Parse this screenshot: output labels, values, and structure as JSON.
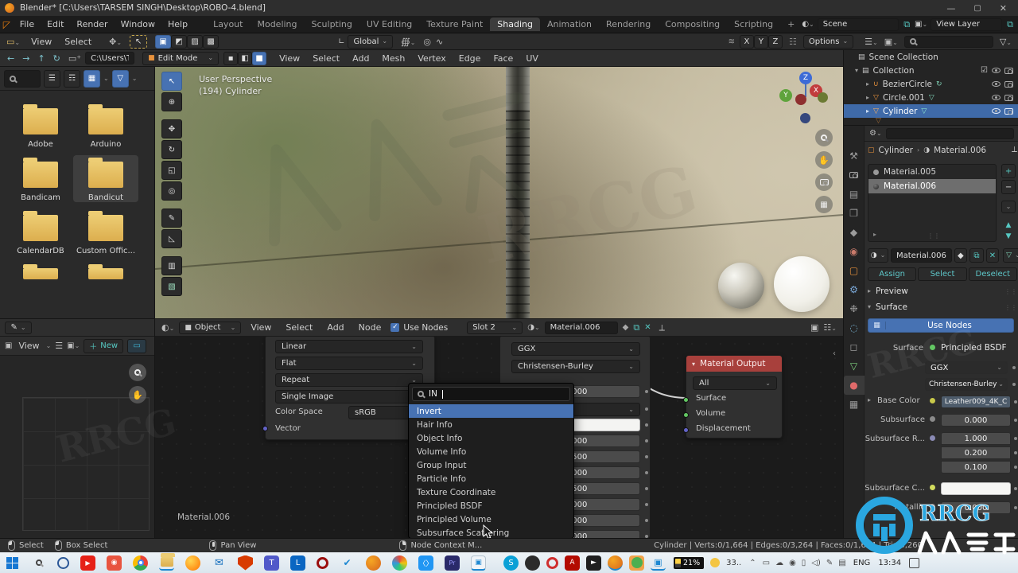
{
  "window": {
    "title": "Blender* [C:\\Users\\TARSEM SINGH\\Desktop\\ROBO-4.blend]"
  },
  "menubar": {
    "menus": [
      "File",
      "Edit",
      "Render",
      "Window",
      "Help"
    ],
    "tabs": [
      "Layout",
      "Modeling",
      "Sculpting",
      "UV Editing",
      "Texture Paint",
      "Shading",
      "Animation",
      "Rendering",
      "Compositing",
      "Scripting"
    ],
    "add_tab": "+",
    "scene_label": "Scene",
    "view_layer_label": "View Layer"
  },
  "toolrow": {
    "orientation": "Global",
    "mirror": [
      "X",
      "Y",
      "Z"
    ],
    "options": "Options"
  },
  "filebrowser": {
    "menus": [
      "View",
      "Select"
    ],
    "path": "C:\\Users\\T...",
    "folders": [
      "Adobe",
      "Arduino",
      "Bandicam",
      "Bandicut",
      "CalendarDB",
      "Custom Offic..."
    ]
  },
  "imageeditor": {
    "view_menu": "View",
    "new_label": "New"
  },
  "viewport": {
    "mode": "Edit Mode",
    "menus": [
      "View",
      "Select",
      "Add",
      "Mesh",
      "Vertex",
      "Edge",
      "Face",
      "UV"
    ],
    "overlay_line1": "User Perspective",
    "overlay_line2": "(194) Cylinder",
    "axis_x": "X",
    "axis_y": "Y",
    "axis_z": "Z"
  },
  "outliner": {
    "items": [
      {
        "label": "Scene Collection"
      },
      {
        "label": "Collection"
      },
      {
        "label": "BezierCircle"
      },
      {
        "label": "Circle.001"
      },
      {
        "label": "Cylinder"
      }
    ]
  },
  "properties": {
    "breadcrumb": {
      "object": "Cylinder",
      "material": "Material.006"
    },
    "slots": [
      {
        "name": "Material.005"
      },
      {
        "name": "Material.006"
      }
    ],
    "datablock": "Material.006",
    "actions": [
      "Assign",
      "Select",
      "Deselect"
    ],
    "preview_label": "Preview",
    "surface_label": "Surface",
    "use_nodes": "Use Nodes",
    "surface_field": {
      "label": "Surface",
      "value": "Principled BSDF"
    },
    "distribution": "GGX",
    "subsurface_method": "Christensen-Burley",
    "base_color": {
      "label": "Base Color",
      "value": "Leather009_4K_C"
    },
    "subsurface": {
      "label": "Subsurface",
      "value": "0.000"
    },
    "subsurface_radius": {
      "label": "Subsurface R...",
      "values": [
        "1.000",
        "0.200",
        "0.100"
      ]
    },
    "subsurface_color_label": "Subsurface C...",
    "metallic": {
      "label": "Metallic",
      "value": "0.000"
    }
  },
  "nodeeditor": {
    "header": {
      "type": "Object",
      "menus": [
        "View",
        "Select",
        "Add",
        "Node"
      ],
      "use_nodes": "Use Nodes",
      "slot": "Slot 2",
      "material": "Material.006"
    },
    "tex_node": {
      "rows": [
        "Linear",
        "Flat",
        "Repeat",
        "Single Image"
      ],
      "cs_label": "Color Space",
      "cs_value": "sRGB",
      "input": "Vector"
    },
    "bsdf": {
      "distribution": "GGX",
      "method": "Christensen-Burley",
      "values": [
        "0.000",
        "0.000",
        "0.500",
        "0.000",
        "0.500",
        "0.000",
        "0.000",
        "0.000"
      ]
    },
    "output": {
      "title": "Material Output",
      "target": "All",
      "inputs": [
        "Surface",
        "Volume",
        "Displacement"
      ]
    },
    "search": {
      "query": "IN",
      "results": [
        "Invert",
        "Hair Info",
        "Object Info",
        "Volume Info",
        "Group Input",
        "Particle Info",
        "Texture Coordinate",
        "Principled BSDF",
        "Principled Volume",
        "Subsurface Scattering"
      ]
    },
    "material_label": "Material.006"
  },
  "statusbar": {
    "hints": [
      "Select",
      "Box Select",
      "Pan View",
      "Node Context M..."
    ],
    "stats": "Cylinder | Verts:0/1,664 | Edges:0/3,264 | Faces:0/1,604 | Tris:3,260"
  },
  "taskbar": {
    "battery": "21%",
    "overflow": "33..",
    "lang": "ENG",
    "time": "13:34"
  },
  "watermark": {
    "brand": "RRCG"
  },
  "colors": {
    "accent_blue": "#4772b3",
    "teal": "#4fc1c6",
    "object_orange": "#e8923c",
    "header_red": "#a8403c",
    "folder_yellow": "#e6c068"
  }
}
